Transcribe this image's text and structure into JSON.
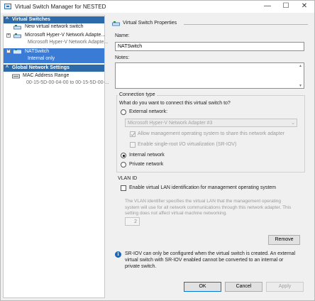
{
  "window": {
    "title": "Virtual Switch Manager for NESTED",
    "min_glyph": "—",
    "max_glyph": "☐",
    "close_glyph": "✕"
  },
  "sidebar": {
    "virtual_switches_header": "Virtual Switches",
    "global_settings_header": "Global Network Settings",
    "collapse_glyph": "☐",
    "items": [
      {
        "label": "New virtual network switch",
        "sub": "",
        "expander": "",
        "selected": false,
        "icon": "network-switch-icon"
      },
      {
        "label": "Microsoft Hyper-V Network Adapte...",
        "sub": "Microsoft Hyper-V Network Adapte...",
        "expander": "+",
        "selected": false,
        "icon": "network-switch-icon"
      },
      {
        "label": "NATSwitch",
        "sub": "Internal only",
        "expander": "+",
        "selected": true,
        "icon": "network-switch-icon"
      }
    ],
    "mac_range": {
      "label": "MAC Address Range",
      "value": "00-15-5D-00-04-00 to 00-15-5D-00-..."
    }
  },
  "properties": {
    "header": "Virtual Switch Properties",
    "name_label": "Name:",
    "name_value": "NATSwitch",
    "notes_label": "Notes:",
    "notes_value": "",
    "connection_type": {
      "title": "Connection type",
      "question": "What do you want to connect this virtual switch to?",
      "external_label": "External network:",
      "adapter_selected": "Microsoft Hyper-V Network Adapter #3",
      "allow_mgmt_label": "Allow management operating system to share this network adapter",
      "sriov_label": "Enable single-root I/O virtualization (SR-IOV)",
      "internal_label": "Internal network",
      "private_label": "Private network",
      "selected": "internal"
    },
    "vlan": {
      "title": "VLAN ID",
      "enable_label": "Enable virtual LAN identification for management operating system",
      "description": "The VLAN identifier specifies the virtual LAN that the management operating system will use for all network communications through this network adapter. This setting does not affect virtual machine networking.",
      "id_value": "2"
    },
    "remove_label": "Remove",
    "info_text": "SR-IOV can only be configured when the virtual switch is created. An external virtual switch with SR-IOV enabled cannot be converted to an internal or private switch."
  },
  "footer": {
    "ok_label": "OK",
    "cancel_label": "Cancel",
    "apply_label": "Apply"
  },
  "colors": {
    "section_header": "#2d6aa9",
    "selection": "#3a7bd5",
    "info_icon": "#1c65b7"
  }
}
